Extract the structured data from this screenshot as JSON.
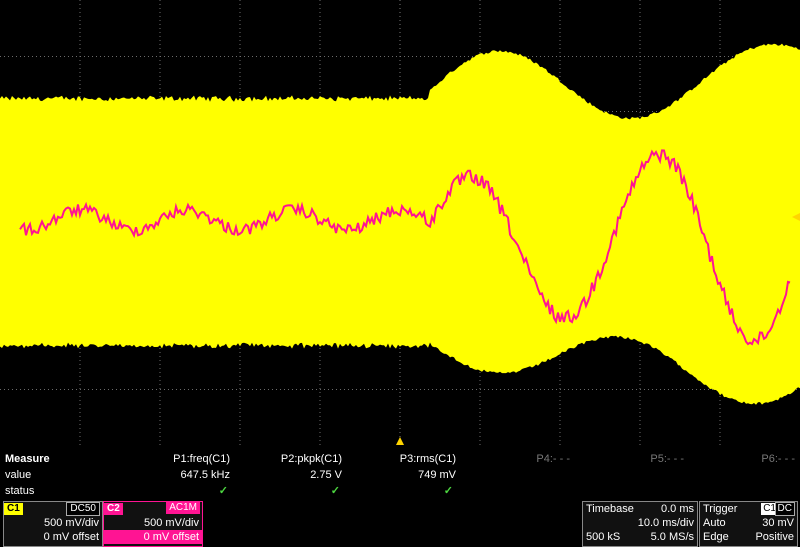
{
  "scope": {
    "channel_marker": "C1",
    "colors": {
      "c1": "#ffff00",
      "c2": "#ff1493",
      "grid": "#777777",
      "trigger_marker": "#ffd400"
    }
  },
  "measure": {
    "title": "Measure",
    "row_value_label": "value",
    "row_status_label": "status",
    "params": [
      {
        "name": "P1:freq(C1)",
        "value": "647.5 kHz",
        "status": "✓",
        "active": true
      },
      {
        "name": "P2:pkpk(C1)",
        "value": "2.75 V",
        "status": "✓",
        "active": true
      },
      {
        "name": "P3:rms(C1)",
        "value": "749 mV",
        "status": "✓",
        "active": true
      },
      {
        "name": "P4:- - -",
        "value": "",
        "status": "",
        "active": false
      },
      {
        "name": "P5:- - -",
        "value": "",
        "status": "",
        "active": false
      },
      {
        "name": "P6:- - -",
        "value": "",
        "status": "",
        "active": false
      }
    ]
  },
  "channels": [
    {
      "id": "C1",
      "coupling": "DC50",
      "vdiv": "500 mV/div",
      "offset": "0 mV offset",
      "color": "#ffff00"
    },
    {
      "id": "C2",
      "coupling": "AC1M",
      "vdiv": "500 mV/div",
      "offset": "0 mV offset",
      "color": "#ff1493"
    }
  ],
  "timebase": {
    "label": "Timebase",
    "delay": "0.0 ms",
    "tdiv": "10.0 ms/div",
    "samples": "500 kS",
    "rate": "5.0 MS/s"
  },
  "trigger": {
    "label": "Trigger",
    "source": "C1",
    "coupling": "DC",
    "mode": "Auto",
    "level": "30 mV",
    "type": "Edge",
    "slope": "Positive"
  }
}
